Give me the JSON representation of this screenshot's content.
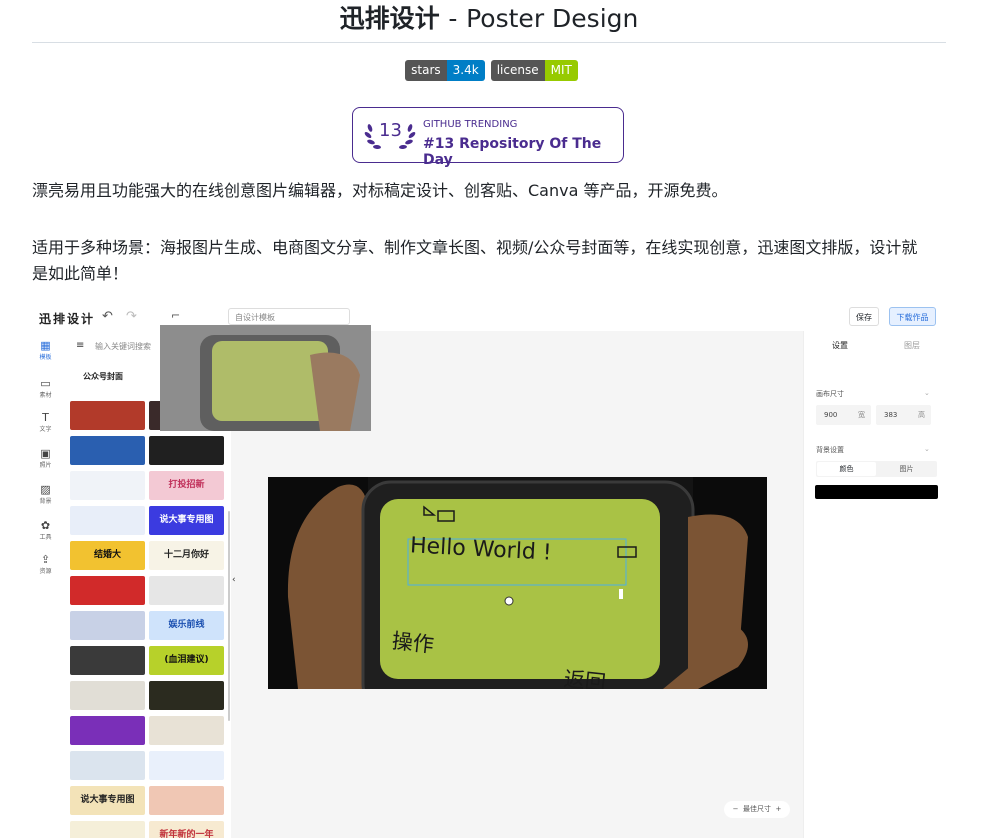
{
  "title": {
    "cn": "迅排设计",
    "sep": "-",
    "en": "Poster Design"
  },
  "badges": [
    {
      "label": "stars",
      "value": "3.4k",
      "color": "#007ec6"
    },
    {
      "label": "license",
      "value": "MIT",
      "color": "#97ca00"
    }
  ],
  "trending": {
    "rank": "13",
    "small": "GITHUB TRENDING",
    "big": "#13 Repository Of The Day",
    "color": "#4a2c8f"
  },
  "desc1": "漂亮易用且功能强大的在线创意图片编辑器，对标稿定设计、创客贴、Canva 等产品，开源免费。",
  "desc2": "适用于多种场景：海报图片生成、电商图文分享、制作文章长图、视频/公众号封面等，在线实现创意，迅速图文排版，设计就是如此简单！",
  "editor": {
    "logo": "迅排设计",
    "search_template": "自设计模板",
    "save": "保存",
    "download": "下载作品",
    "rail": [
      {
        "icon": "template-icon",
        "glyph": "▦",
        "label": "模板"
      },
      {
        "icon": "folder-icon",
        "glyph": "▭",
        "label": "素材"
      },
      {
        "icon": "text-icon",
        "glyph": "T",
        "label": "文字"
      },
      {
        "icon": "image-icon",
        "glyph": "▣",
        "label": "照片"
      },
      {
        "icon": "brush-icon",
        "glyph": "▨",
        "label": "背景"
      },
      {
        "icon": "tool-icon",
        "glyph": "✿",
        "label": "工具"
      },
      {
        "icon": "upload-icon",
        "glyph": "⇪",
        "label": "资源"
      }
    ],
    "panel_search_placeholder": "输入关键词搜索",
    "category": "公众号封面",
    "thumbs": [
      {
        "text": "",
        "bg": "#b23a2a",
        "fg": "#fff"
      },
      {
        "text": "",
        "bg": "#3a2a2a",
        "fg": "#fff"
      },
      {
        "text": "",
        "bg": "#2a5fb0",
        "fg": "#fff"
      },
      {
        "text": "",
        "bg": "#202020",
        "fg": "#f5d34b"
      },
      {
        "text": "",
        "bg": "#f0f3f8",
        "fg": "#333"
      },
      {
        "text": "打投招新",
        "bg": "#f3c9d4",
        "fg": "#c0305a"
      },
      {
        "text": "",
        "bg": "#e8eef9",
        "fg": "#555"
      },
      {
        "text": "说大事专用图",
        "bg": "#3b3be0",
        "fg": "#fff"
      },
      {
        "text": "结婚大",
        "bg": "#f2c230",
        "fg": "#111"
      },
      {
        "text": "十二月你好",
        "bg": "#f7f3e6",
        "fg": "#222"
      },
      {
        "text": "",
        "bg": "#d12a2a",
        "fg": "#fff"
      },
      {
        "text": "",
        "bg": "#e6e6e6",
        "fg": "#333"
      },
      {
        "text": "",
        "bg": "#c8d1e6",
        "fg": "#333"
      },
      {
        "text": "娱乐前线",
        "bg": "#cfe3fb",
        "fg": "#1a4fb0"
      },
      {
        "text": "",
        "bg": "#3a3a3a",
        "fg": "#fff"
      },
      {
        "text": "(血泪建议)",
        "bg": "#b7d12a",
        "fg": "#111"
      },
      {
        "text": "",
        "bg": "#e1ded6",
        "fg": "#333"
      },
      {
        "text": "",
        "bg": "#2b2b1f",
        "fg": "#c9d64b"
      },
      {
        "text": "",
        "bg": "#7a2fb8",
        "fg": "#fff"
      },
      {
        "text": "",
        "bg": "#e8e2d6",
        "fg": "#333"
      },
      {
        "text": "",
        "bg": "#dbe4ee",
        "fg": "#333"
      },
      {
        "text": "",
        "bg": "#e9f0fb",
        "fg": "#333"
      },
      {
        "text": "说大事专用图",
        "bg": "#f3e3b8",
        "fg": "#222"
      },
      {
        "text": "",
        "bg": "#f0c7b4",
        "fg": "#c0303a"
      },
      {
        "text": "",
        "bg": "#f5efd9",
        "fg": "#222"
      },
      {
        "text": "新年新的一年",
        "bg": "#f7ead1",
        "fg": "#c0303a"
      }
    ],
    "poster": {
      "hello": "Hello World !",
      "op": "操作",
      "back": "返回",
      "bg": "#0b0b0b",
      "screen": "#a9c245",
      "hand": "#7b5434"
    },
    "zoom": "最佳尺寸",
    "right": {
      "tab1": "设置",
      "tab2": "图层",
      "canvas_size": "画布尺寸",
      "width": "900",
      "width_unit": "宽",
      "height": "383",
      "height_unit": "高",
      "bg_setting": "背景设置",
      "seg_color": "颜色",
      "seg_image": "图片",
      "bg_color": "#000000"
    }
  }
}
